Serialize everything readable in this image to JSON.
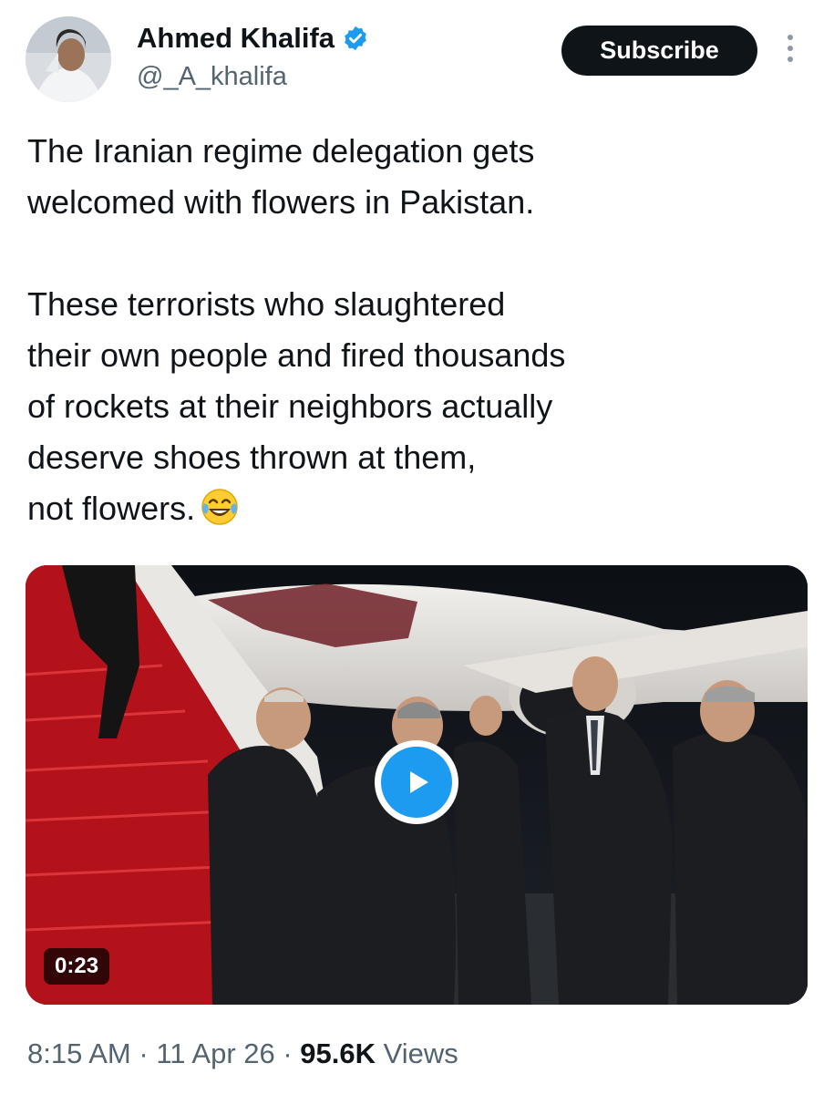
{
  "author": {
    "name": "Ahmed Khalifa",
    "handle": "@_A_khalifa",
    "verified_icon": "verified-badge-icon",
    "verified_color": "#1d9bf0"
  },
  "header": {
    "subscribe_label": "Subscribe",
    "more_icon": "more-vertical-icon"
  },
  "tweet": {
    "text": "The Iranian regime delegation gets\nwelcomed with flowers in Pakistan.\n\nThese terrorists who slaughtered\ntheir own people and fired thousands\nof rockets at their neighbors actually\ndeserve shoes thrown at them,\nnot flowers.",
    "emoji": "face-with-tears-of-joy"
  },
  "media": {
    "type": "video",
    "duration": "0:23",
    "play_icon": "play-icon",
    "accent_color": "#1d9bf0"
  },
  "meta": {
    "time": "8:15 AM",
    "separator": " · ",
    "date": "11 Apr 26",
    "views_count": "95.6K",
    "views_label": "Views"
  }
}
